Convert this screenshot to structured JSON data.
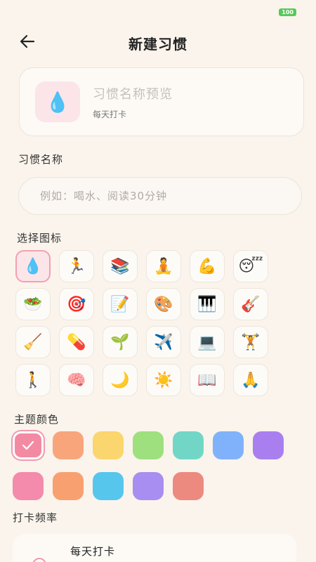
{
  "header": {
    "title": "新建习惯"
  },
  "preview": {
    "icon": "💧",
    "name": "习惯名称预览",
    "frequency": "每天打卡"
  },
  "name_section": {
    "label": "习惯名称",
    "placeholder": "例如：喝水、阅读30分钟",
    "value": ""
  },
  "icon_section": {
    "label": "选择图标",
    "icons": [
      {
        "glyph": "💧",
        "name": "water-drop-icon",
        "selected": true
      },
      {
        "glyph": "🏃",
        "name": "running-icon"
      },
      {
        "glyph": "📚",
        "name": "books-icon"
      },
      {
        "glyph": "🧘",
        "name": "meditation-icon"
      },
      {
        "glyph": "💪",
        "name": "muscle-icon"
      },
      {
        "glyph": "😴",
        "name": "sleep-icon"
      },
      {
        "glyph": "🥗",
        "name": "salad-icon"
      },
      {
        "glyph": "🎯",
        "name": "target-icon"
      },
      {
        "glyph": "📝",
        "name": "memo-icon"
      },
      {
        "glyph": "🎨",
        "name": "palette-icon"
      },
      {
        "glyph": "🎹",
        "name": "piano-icon"
      },
      {
        "glyph": "🎸",
        "name": "guitar-icon"
      },
      {
        "glyph": "🧹",
        "name": "broom-icon"
      },
      {
        "glyph": "💊",
        "name": "pill-icon"
      },
      {
        "glyph": "🌱",
        "name": "seedling-icon"
      },
      {
        "glyph": "✈️",
        "name": "airplane-icon"
      },
      {
        "glyph": "💻",
        "name": "laptop-icon"
      },
      {
        "glyph": "🏋️",
        "name": "weightlifting-icon"
      },
      {
        "glyph": "🚶",
        "name": "walking-icon"
      },
      {
        "glyph": "🧠",
        "name": "brain-icon"
      },
      {
        "glyph": "🌙",
        "name": "moon-icon"
      },
      {
        "glyph": "☀️",
        "name": "sun-icon"
      },
      {
        "glyph": "📖",
        "name": "open-book-icon"
      },
      {
        "glyph": "🙏",
        "name": "pray-icon"
      }
    ]
  },
  "color_section": {
    "label": "主题颜色",
    "colors": [
      "#f38aa3",
      "#f9a57c",
      "#fbd56e",
      "#9ee07e",
      "#72d6c6",
      "#80b2fb",
      "#a97ff0",
      "#f48aac",
      "#f9a070",
      "#57c6ed",
      "#a88ef0",
      "#ec8a80"
    ],
    "selected_index": 0
  },
  "frequency_section": {
    "label": "打卡频率",
    "selected_option": "每天打卡"
  }
}
